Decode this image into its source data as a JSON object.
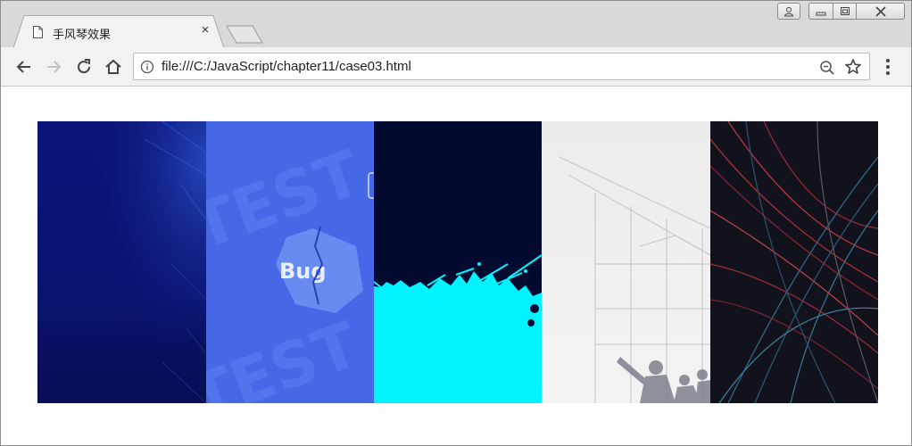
{
  "browser": {
    "tab": {
      "title": "手风琴效果",
      "icon": "document-icon",
      "close_label": "×"
    },
    "window_controls": [
      "user-icon",
      "minimize-icon",
      "maximize-icon",
      "close-icon"
    ],
    "toolbar": {
      "back_icon": "back-arrow-icon",
      "forward_icon": "forward-arrow-icon",
      "reload_icon": "reload-icon",
      "home_icon": "home-icon",
      "url": "file:///C:/JavaScript/chapter11/case03.html",
      "info_icon": "info-icon",
      "zoom_icon": "zoom-icon",
      "bookmark_icon": "star-icon",
      "menu_icon": "menu-dots-icon"
    }
  },
  "page": {
    "accordion": {
      "panels": [
        {
          "name": "blue-tech-background",
          "colors": [
            "#0a1170",
            "#0a0f5a"
          ]
        },
        {
          "name": "bug-test-image",
          "colors": [
            "#4a6ae8",
            "#3e5fe0"
          ],
          "badge_text": "Bug"
        },
        {
          "name": "cyan-splash-image",
          "colors": [
            "#020a2e",
            "#00f4ff"
          ]
        },
        {
          "name": "grey-architecture-image",
          "colors": [
            "#eeeeee",
            "#8a8a92"
          ]
        },
        {
          "name": "red-lines-abstract",
          "colors": [
            "#12121c",
            "#b32a34"
          ]
        }
      ]
    }
  }
}
